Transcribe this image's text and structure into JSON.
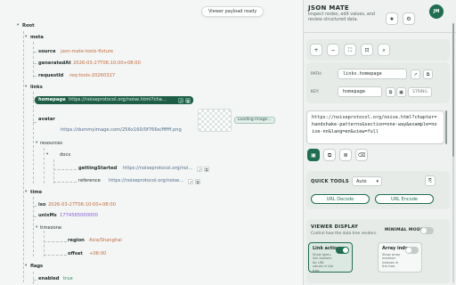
{
  "toast": "Viewer payload ready",
  "tree": {
    "root": "Root",
    "meta": {
      "label": "meta",
      "source": {
        "key": "source",
        "value": "json-mate-tools-fixture"
      },
      "generatedAt": {
        "key": "generatedAt",
        "value": "2026-03-27T06:10:00+08:00"
      },
      "requestId": {
        "key": "requestId",
        "value": "req-tools-20260327"
      }
    },
    "links": {
      "label": "links",
      "homepage": {
        "key": "homepage",
        "value": "https://noiseprotocol.org/noise.html?chapter=han..."
      },
      "avatar": {
        "key": "avatar",
        "value": "https://dummyimage.com/256x160/0f766e/ffffff.png",
        "loading": "Loading image..."
      },
      "resources": {
        "label": "resources",
        "docs": {
          "label": "docs",
          "gettingStarted": {
            "key": "gettingStarted",
            "value": "https://noiseprotocol.org/noise.html#introductiv..."
          },
          "reference": {
            "key": "reference",
            "value": "https://noiseprotocol.org/noise.html#interactive..."
          }
        }
      }
    },
    "time": {
      "label": "time",
      "iso": {
        "key": "iso",
        "value": "2026-03-27T06:10:00+08:00"
      },
      "unixMs": {
        "key": "unixMs",
        "value": "1774565000000"
      },
      "timezone": {
        "label": "timezone",
        "region": {
          "key": "region",
          "value": "Asia/Shanghai"
        },
        "offset": {
          "key": "offset",
          "value": "+08:00"
        }
      }
    },
    "flags": {
      "label": "flags",
      "enabled": {
        "key": "enabled",
        "value": "true"
      }
    }
  },
  "panel": {
    "title": "JSON MATE",
    "subtitle": "Inspect nodes, edit values, and review structured data.",
    "avatar": "JM",
    "path_label": "PATH:",
    "path_value": "links.homepage",
    "key_label": "KEY:",
    "key_value": "homepage",
    "type_tag": "STRING",
    "value_text": "https://noiseprotocol.org/noise.html?chapter=handshake-patterns&section=one-way&example=noise-nn&lang=en&view=full",
    "quick_tools": "QUICK TOOLS",
    "quick_select": "Auto",
    "url_decode": "URL Decode",
    "url_encode": "URL Encode",
    "viewer_display": "VIEWER DISPLAY",
    "viewer_desc": "Control how the data tree renders.",
    "minimal_mode": "MINIMAL MODE",
    "link_actions": {
      "title": "Link actions",
      "desc": "Show open-link buttons for URL values in the tree."
    },
    "array_indexes": {
      "title": "Array indexes",
      "desc": "Show array member indexes in the tree."
    }
  },
  "icons": {
    "expand": "chevron-down-icon",
    "open": "external-link-icon",
    "star": "star-icon",
    "settings": "gear-icon"
  },
  "colors": {
    "accent": "#1f6e52",
    "string": "#c26a3c",
    "number": "#8a5bd6",
    "bool": "#2e8a5c"
  }
}
